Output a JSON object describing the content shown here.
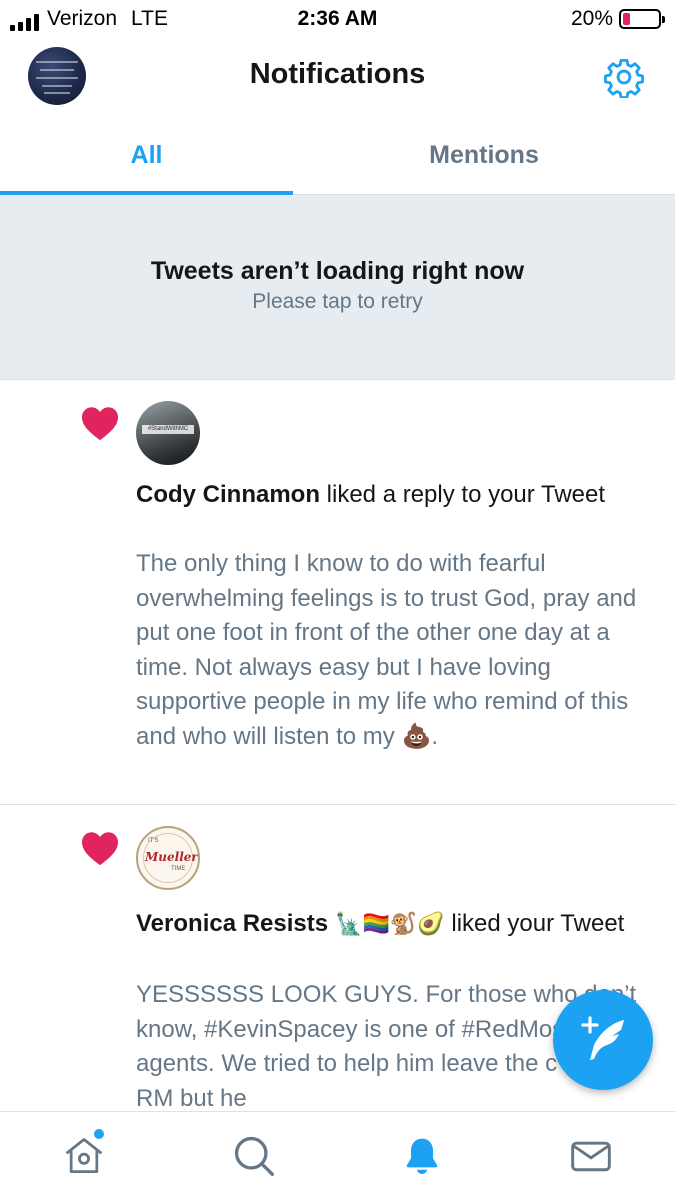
{
  "status_bar": {
    "carrier": "Verizon",
    "network": "LTE",
    "time": "2:36 AM",
    "battery_percent": "20%",
    "battery_level": 0.2
  },
  "header": {
    "title": "Notifications",
    "avatar_icon": "profile-avatar",
    "settings_icon": "gear-icon"
  },
  "tabs": [
    {
      "label": "All",
      "active": true
    },
    {
      "label": "Mentions",
      "active": false
    }
  ],
  "error_banner": {
    "title": "Tweets aren’t loading right now",
    "subtitle": "Please tap to retry"
  },
  "notifications": [
    {
      "icon": "heart-icon",
      "user": "Cody Cinnamon",
      "user_emoji": "",
      "action": " liked a reply to your Tweet",
      "tweet": "The only thing I know to do with fearful overwhelming feelings is to trust God, pray and put one foot in front of the other one day at a time. Not always easy but I have loving supportive people in my life who remind of this and who will listen to my 💩."
    },
    {
      "icon": "heart-icon",
      "user": "Veronica Resists",
      "user_emoji": " 🗽🏳️‍🌈🐒🥑",
      "action": " liked your Tweet",
      "tweet": "YESSSSSS LOOK GUYS. For those who don’t know, #KevinSpacey is one of #RedMossad agents. We tried to help him leave the c*lt and RM but he"
    }
  ],
  "fab": {
    "icon": "compose-tweet-icon"
  },
  "tab_bar": [
    {
      "icon": "home-icon",
      "active": false,
      "has_dot": true
    },
    {
      "icon": "search-icon",
      "active": false
    },
    {
      "icon": "notifications-bell-icon",
      "active": true
    },
    {
      "icon": "messages-envelope-icon",
      "active": false
    }
  ],
  "colors": {
    "accent": "#1da1f2",
    "heart": "#e0245e",
    "secondary_text": "#657786",
    "banner_bg": "#e6ecf0"
  }
}
